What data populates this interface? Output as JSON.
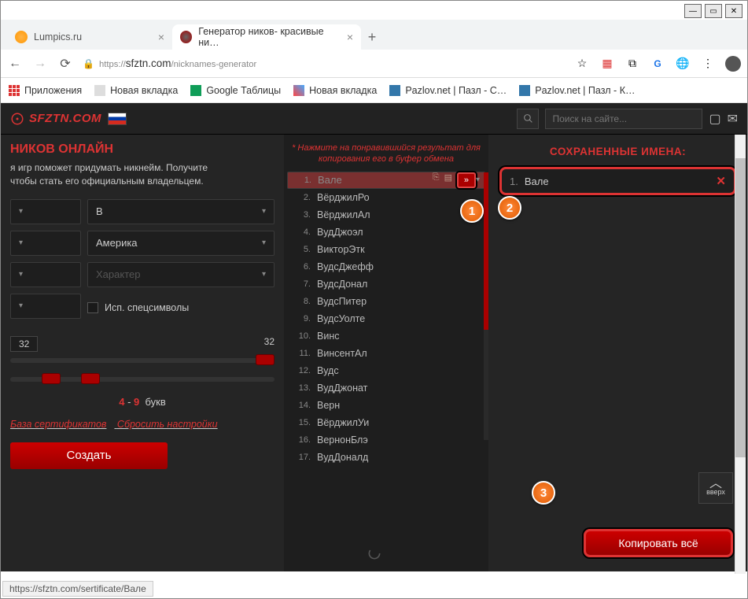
{
  "window": {
    "min": "—",
    "max": "▭",
    "close": "✕"
  },
  "tabs": [
    {
      "title": "Lumpics.ru",
      "active": false
    },
    {
      "title": "Генератор ников- красивые ни…",
      "active": true
    }
  ],
  "url": {
    "scheme": "https://",
    "host": "sfztn.com",
    "path": "/nicknames-generator"
  },
  "bookmarks": {
    "apps": "Приложения",
    "items": [
      "Новая вкладка",
      "Google Таблицы",
      "Новая вкладка",
      "Pazlov.net | Пазл - С…",
      "Pazlov.net | Пазл - К…"
    ]
  },
  "topbar": {
    "logo": "SFZTN.COM",
    "search_placeholder": "Поиск на сайте..."
  },
  "left": {
    "title": "НИКОВ ОНЛАЙН",
    "desc1": "я игр поможет придумать никнейм. Получите",
    "desc2": "чтобы стать его официальным владельцем.",
    "sel_b": "В",
    "sel_country": "Америка",
    "sel_character": "Характер",
    "chk_label": "Исп. спецсимволы",
    "count_val": "32",
    "count_max": "32",
    "letters_min": "4",
    "letters_max": "9",
    "letters_word": "букв",
    "link_db": "База сертификатов",
    "link_reset": "Сбросить настройки",
    "create": "Создать"
  },
  "mid": {
    "hint": "* Нажмите на понравившийся результат для копирования его в буфер обмена",
    "items": [
      "Вале",
      "ВёрджилРо",
      "ВёрджилАл",
      "ВудДжоэл",
      "ВикторЭтк",
      "ВудсДжефф",
      "ВудсДонал",
      "ВудсПитер",
      "ВудсУолте",
      "Винс",
      "ВинсентАл",
      "Вудс",
      "ВудДжонат",
      "Верн",
      "ВёрджилУи",
      "ВернонБлэ",
      "ВудДоналд"
    ]
  },
  "right": {
    "title": "СОХРАНЕННЫЕ ИМЕНА:",
    "items": [
      "Вале"
    ],
    "copy_all": "Копировать всё",
    "up": "вверх"
  },
  "status": "https://sfztn.com/sertificate/Вале",
  "badges": {
    "b1": "1",
    "b2": "2",
    "b3": "3"
  }
}
